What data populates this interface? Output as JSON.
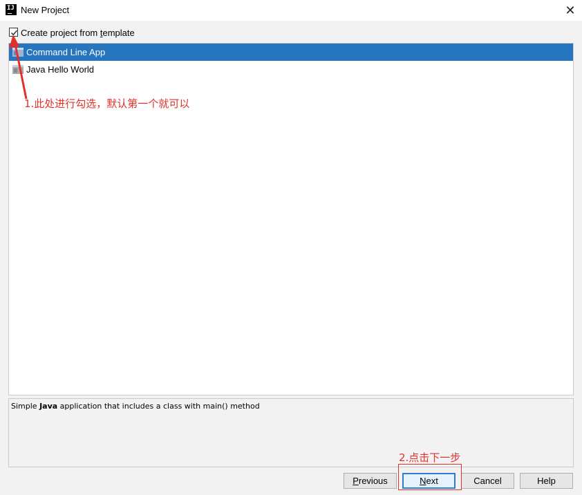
{
  "window": {
    "icon_text": "IJ",
    "title": "New Project",
    "close_glyph": "✕"
  },
  "template_checkbox": {
    "label_before": "Create project from ",
    "label_mnemonic": "t",
    "label_after": "emplate",
    "checked": true
  },
  "templates": [
    {
      "label": "Command Line App",
      "selected": true,
      "icon": "module-template-icon"
    },
    {
      "label": "Java Hello World",
      "selected": false,
      "icon": "module-template-icon"
    }
  ],
  "description": {
    "before": "Simple ",
    "bold": "Java",
    "after": " application that includes a class with main() method"
  },
  "buttons": {
    "previous": {
      "mnemonic": "P",
      "rest": "revious"
    },
    "next": {
      "mnemonic": "N",
      "rest": "ext"
    },
    "cancel": "Cancel",
    "help": "Help"
  },
  "annotations": {
    "note1": "1.此处进行勾选，默认第一个就可以",
    "note2": "2.点击下一步",
    "color": "#e0302c"
  },
  "colors": {
    "selection": "#2675bf",
    "default_button_border": "#2f7bd2"
  }
}
